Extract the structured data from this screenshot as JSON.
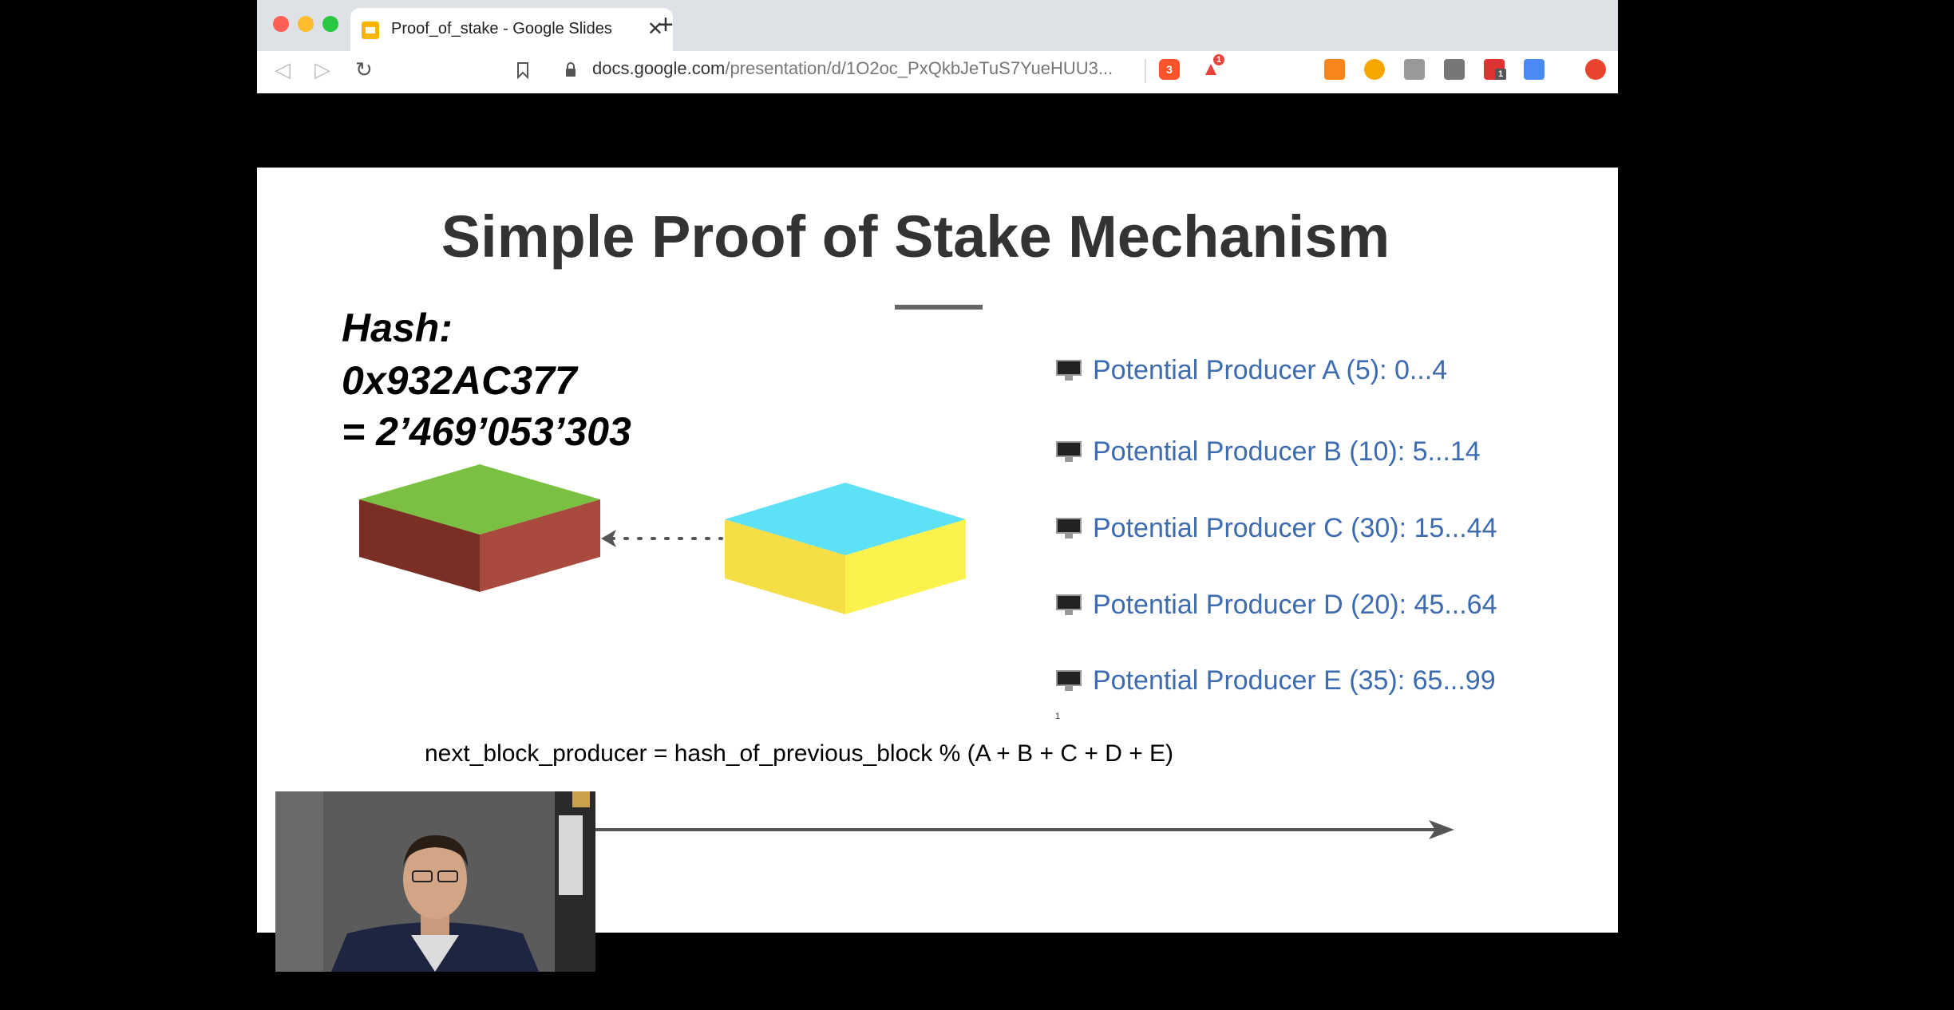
{
  "browser": {
    "tab_title": "Proof_of_stake - Google Slides",
    "tab_close": "✕",
    "new_tab": "+",
    "url_host": "docs.google.com",
    "url_path": "/presentation/d/1O2oc_PxQkbJeTuS7YueHUU3...",
    "extension_badges": [
      "3",
      "1",
      "1"
    ]
  },
  "slide": {
    "title": "Simple Proof of Stake Mechanism",
    "hash_lines": [
      "Hash:",
      "0x932AC377",
      "= 2’469’053’303"
    ],
    "producers": [
      "Potential Producer A (5): 0...4",
      "Potential Producer B (10): 5...14",
      "Potential Producer C (30): 15...44",
      "Potential Producer D (20): 45...64",
      "Potential Producer E (35): 65...99"
    ],
    "footnote": "1",
    "formula": "next_block_producer = hash_of_previous_block % (A + B + C + D + E)"
  },
  "colors": {
    "block_a_top": "#7ac143",
    "block_a_front": "#7a2e24",
    "block_a_side": "#a84a3e",
    "block_b_top": "#5ce1f7",
    "block_b_front": "#f6df46",
    "block_b_side": "#fbf24e",
    "producer_text": "#3d6bb0"
  }
}
